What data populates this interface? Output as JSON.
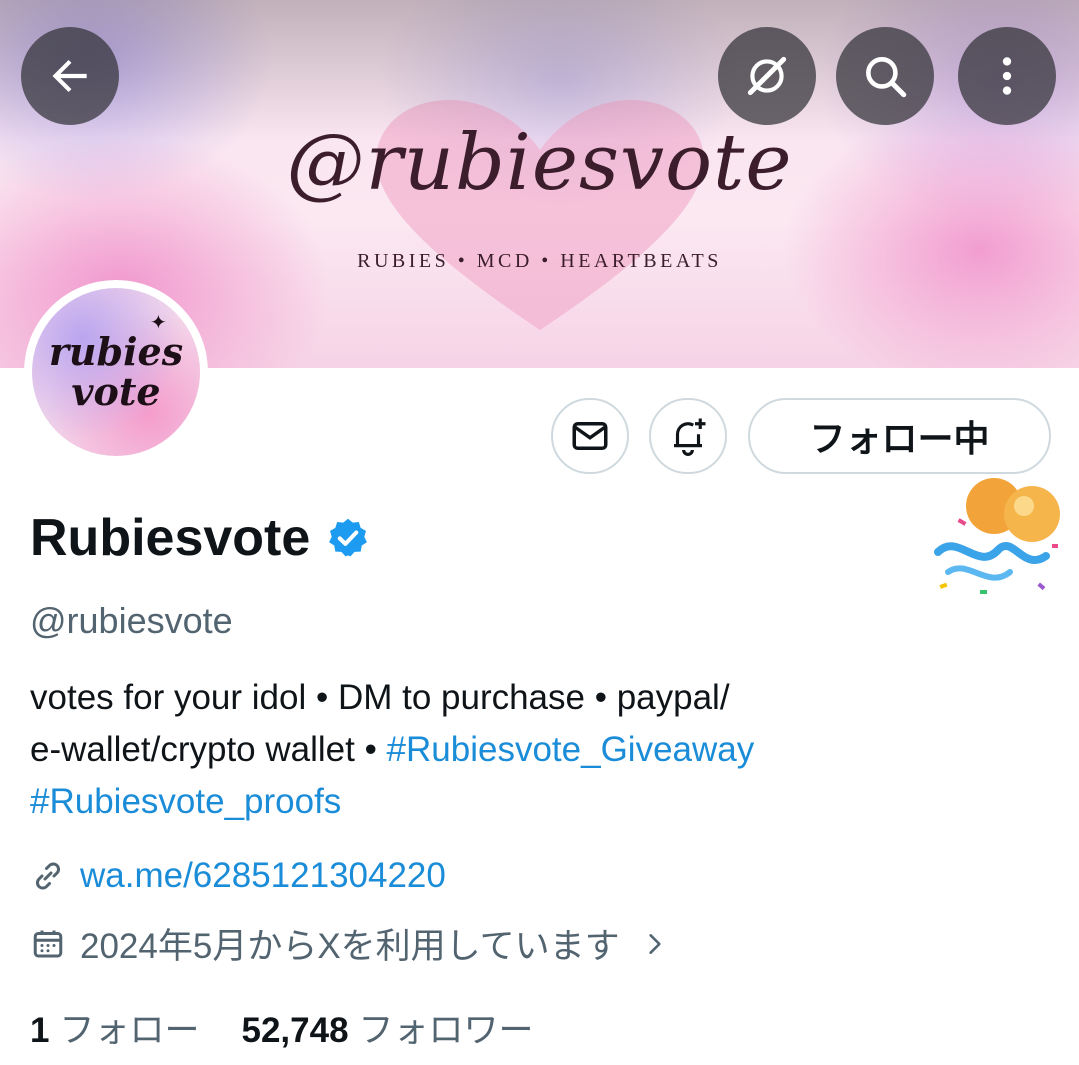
{
  "banner": {
    "handle_art": "@rubiesvote",
    "tagline": "RUBIES • MCD • HEARTBEATS"
  },
  "top_bar": {
    "back_icon": "arrow-left-icon",
    "grok_icon": "grok-icon",
    "search_icon": "search-icon",
    "more_icon": "more-vertical-icon"
  },
  "avatar": {
    "text_line1": "rubies",
    "text_line2": "vote"
  },
  "actions": {
    "message_icon": "mail-icon",
    "notify_icon": "bell-plus-icon",
    "following_label": "フォロー中"
  },
  "profile": {
    "display_name": "Rubiesvote",
    "verified": true,
    "handle": "@rubiesvote",
    "bio_text_1": "votes for your idol • DM to purchase • paypal/",
    "bio_text_2": "e-wallet/crypto wallet • ",
    "bio_hashtag_1": "#Rubiesvote_Giveaway",
    "bio_hashtag_2": "#Rubiesvote_proofs",
    "link": "wa.me/6285121304220",
    "joined": "2024年5月からXを利用しています"
  },
  "stats": {
    "following_count": "1",
    "following_label": "フォロー",
    "followers_count": "52,748",
    "followers_label": "フォロワー"
  },
  "colors": {
    "link": "#1a8cd8",
    "verified": "#1d9bf0",
    "secondary_text": "#536471",
    "border": "#cfd9de"
  }
}
